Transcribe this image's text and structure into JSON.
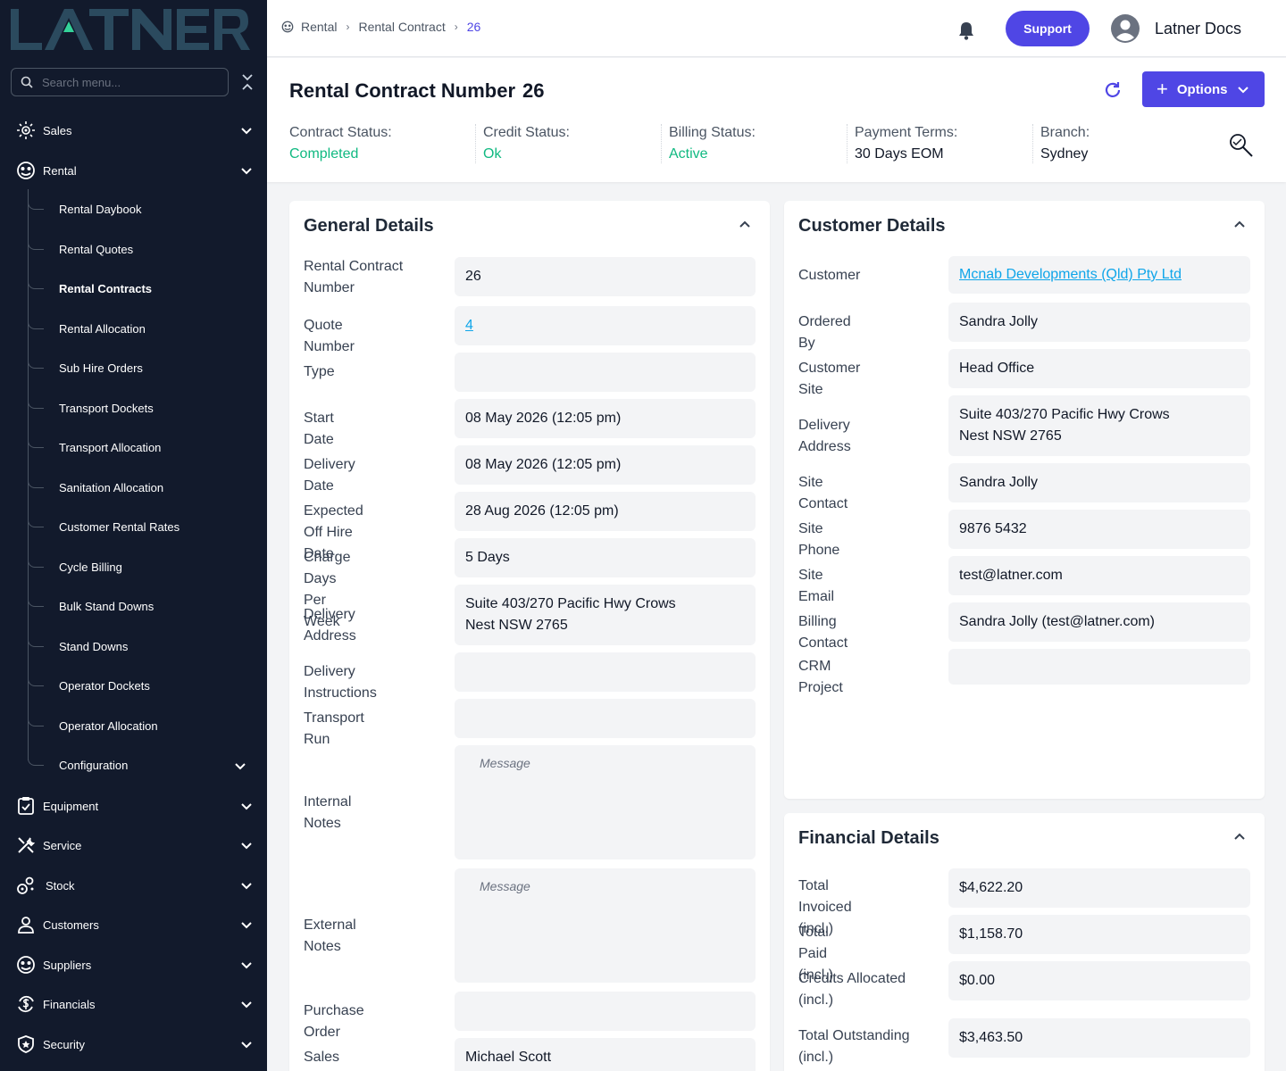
{
  "brand": {
    "logo_text": "LATNER"
  },
  "sidebar": {
    "search_placeholder": "Search menu...",
    "sections": [
      {
        "label": "Sales",
        "icon": "sales-icon"
      },
      {
        "label": "Rental",
        "icon": "rental-icon"
      },
      {
        "label": "Equipment",
        "icon": "clipboard-check-icon"
      },
      {
        "label": "Service",
        "icon": "tools-icon"
      },
      {
        "label": "Stock",
        "icon": "stock-icon"
      },
      {
        "label": "Customers",
        "icon": "user-icon"
      },
      {
        "label": "Suppliers",
        "icon": "suppliers-icon"
      },
      {
        "label": "Financials",
        "icon": "dollar-cycle-icon"
      },
      {
        "label": "Security",
        "icon": "shield-icon"
      }
    ],
    "rental_items": [
      "Rental Daybook",
      "Rental Quotes",
      "Rental Contracts",
      "Rental Allocation",
      "Sub Hire Orders",
      "Transport Dockets",
      "Transport Allocation",
      "Sanitation Allocation",
      "Customer Rental Rates",
      "Cycle Billing",
      "Bulk Stand Downs",
      "Stand Downs",
      "Operator Dockets",
      "Operator Allocation",
      "Configuration"
    ],
    "active_item": "Rental Contracts"
  },
  "topbar": {
    "breadcrumb": [
      "Rental",
      "Rental Contract",
      "26"
    ],
    "support_label": "Support",
    "user_name": "Latner Docs"
  },
  "header": {
    "title_prefix": "Rental Contract Number",
    "title_number": "26",
    "options_label": "Options",
    "statuses": [
      {
        "label": "Contract Status:",
        "value": "Completed",
        "color": "#10b981"
      },
      {
        "label": "Credit Status:",
        "value": "Ok",
        "color": "#10b981"
      },
      {
        "label": "Billing Status:",
        "value": "Active",
        "color": "#10b981"
      },
      {
        "label": "Payment Terms:",
        "value": "30 Days EOM"
      },
      {
        "label": "Branch:",
        "value": "Sydney"
      }
    ]
  },
  "general": {
    "title": "General Details",
    "fields": [
      {
        "label": "Rental Contract Number",
        "value": "26"
      },
      {
        "label": "Quote Number",
        "value": "4",
        "link": true
      },
      {
        "label": "Type",
        "value": ""
      },
      {
        "label": "Start Date",
        "value": "08 May 2026 (12:05 pm)"
      },
      {
        "label": "Delivery Date",
        "value": "08 May 2026 (12:05 pm)"
      },
      {
        "label": "Expected Off Hire Date",
        "value": "28 Aug 2026 (12:05 pm)"
      },
      {
        "label": "Charge Days Per Week",
        "value": "5 Days"
      },
      {
        "label": "Delivery Address",
        "value": "Suite 403/270 Pacific Hwy Crows Nest NSW 2765"
      },
      {
        "label": "Delivery Instructions",
        "value": ""
      },
      {
        "label": "Transport Run",
        "value": ""
      },
      {
        "label": "Internal Notes",
        "placeholder": "Message"
      },
      {
        "label": "External Notes",
        "placeholder": "Message"
      },
      {
        "label": "Purchase Order",
        "value": ""
      },
      {
        "label": "Sales Rep",
        "value": "Michael Scott"
      }
    ]
  },
  "customer": {
    "title": "Customer Details",
    "fields": [
      {
        "label": "Customer",
        "value": "Mcnab Developments (Qld) Pty Ltd",
        "link": true
      },
      {
        "label": "Ordered By",
        "value": "Sandra Jolly"
      },
      {
        "label": "Customer Site",
        "value": "Head Office"
      },
      {
        "label": "Delivery Address",
        "value": "Suite 403/270 Pacific Hwy Crows Nest NSW 2765"
      },
      {
        "label": "Site Contact",
        "value": "Sandra Jolly"
      },
      {
        "label": "Site Phone",
        "value": "9876 5432"
      },
      {
        "label": "Site Email",
        "value": "test@latner.com"
      },
      {
        "label": "Billing Contact",
        "value": "Sandra Jolly (test@latner.com)"
      },
      {
        "label": "CRM Project",
        "value": ""
      }
    ]
  },
  "financial": {
    "title": "Financial Details",
    "fields": [
      {
        "label": "Total Invoiced (incl.)",
        "value": "$4,622.20"
      },
      {
        "label": "Total Paid (incl.)",
        "value": "$1,158.70"
      },
      {
        "label": "Credits Allocated (incl.)",
        "value": "$0.00"
      },
      {
        "label": "Total Outstanding (incl.)",
        "value": "$3,463.50"
      }
    ]
  },
  "colors": {
    "sidebar_bg": "#121a2c",
    "accent": "#4f46e5",
    "status_green": "#10b981",
    "link": "#0ea5e9"
  }
}
